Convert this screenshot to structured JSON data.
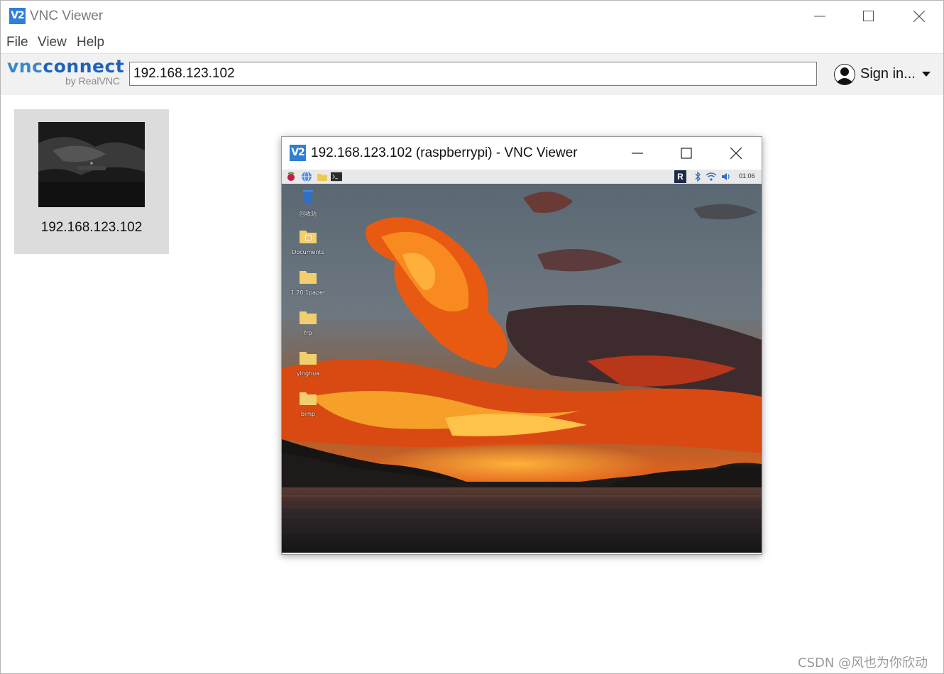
{
  "app": {
    "title": "VNC Viewer",
    "logo_text": "V2"
  },
  "menu": {
    "file": "File",
    "view": "View",
    "help": "Help"
  },
  "toolbar": {
    "brand_vnc": "vnc",
    "brand_connect": "connect",
    "brand_sub": "by RealVNC",
    "address_value": "192.168.123.102",
    "sign_in_label": "Sign in..."
  },
  "connections": [
    {
      "label": "192.168.123.102"
    }
  ],
  "vnc_window": {
    "title": "192.168.123.102 (raspberrypi) - VNC Viewer",
    "logo_text": "V2",
    "taskbar": {
      "tray_app": "R",
      "clock": "01:06"
    },
    "desktop_icons": [
      {
        "label": "回收站",
        "icon": "trash-icon"
      },
      {
        "label": "Documents",
        "icon": "folder-icon"
      },
      {
        "label": "1.20.1paper",
        "icon": "folder-icon"
      },
      {
        "label": "frp",
        "icon": "folder-icon"
      },
      {
        "label": "yinghua",
        "icon": "folder-icon"
      },
      {
        "label": "bimp",
        "icon": "folder-icon"
      }
    ]
  },
  "watermark": "CSDN @风也为你欣动",
  "colors": {
    "accent": "#2f7fd6",
    "brand_vnc": "#3b87c9",
    "brand_connect": "#1e63b8",
    "toolbar_bg": "#f1f1f1",
    "tile_bg": "#dcdcdc"
  }
}
